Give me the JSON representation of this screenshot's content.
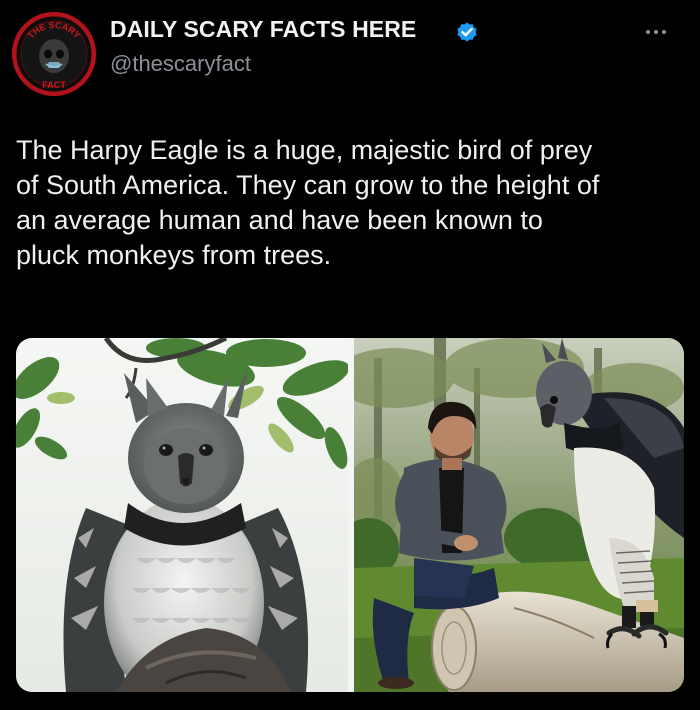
{
  "author": {
    "name": "DAILY SCARY FACTS HERE",
    "handle": "@thescaryfact",
    "verified": true,
    "avatar_text_top": "THE SCARY",
    "avatar_text_bottom": "FACT"
  },
  "post": {
    "text": "The Harpy Eagle is a huge, majestic bird of prey\nof South America. They can grow to the height of\nan average human and have been known to\npluck monkeys from trees."
  },
  "icons": {
    "verified": "verified-badge-icon",
    "more": "more-options-icon"
  },
  "colors": {
    "background": "#000000",
    "text": "#e7e9ea",
    "secondary_text": "#8b9097",
    "verified_blue": "#1d9bf0",
    "avatar_red": "#c0141a"
  }
}
